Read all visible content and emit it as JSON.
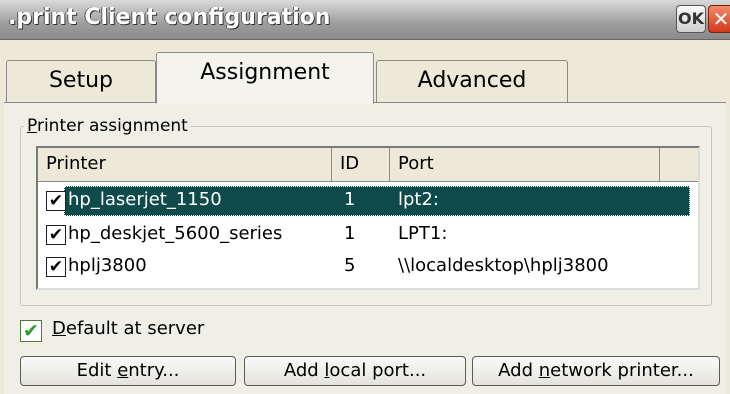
{
  "window": {
    "title": ".print Client configuration",
    "ok_label": "OK",
    "close_glyph": "✕"
  },
  "tabs": [
    {
      "label": "Setup"
    },
    {
      "label": "Assignment"
    },
    {
      "label": "Advanced"
    }
  ],
  "active_tab": "Assignment",
  "group": {
    "label_first": "P",
    "label_rest": "rinter assignment"
  },
  "table": {
    "columns": [
      "Printer",
      "ID",
      "Port"
    ],
    "rows": [
      {
        "checked": "✔",
        "printer": "hp_laserjet_1150",
        "id": "1",
        "port": "lpt2:",
        "selected": true
      },
      {
        "checked": "✔",
        "printer": "hp_deskjet_5600_series",
        "id": "1",
        "port": "LPT1:",
        "selected": false
      },
      {
        "checked": "✔",
        "printer": "hplj3800",
        "id": "5",
        "port": "\\\\localdesktop\\hplj3800",
        "selected": false
      }
    ]
  },
  "default_server": {
    "checked": "✔",
    "label_first": "D",
    "label_rest": "efault at server"
  },
  "buttons": {
    "edit": {
      "before": "Edit ",
      "underlined": "e",
      "after": "ntry..."
    },
    "add_local": {
      "before": "Add ",
      "underlined": "l",
      "after": "ocal port..."
    },
    "add_network": {
      "before": "Add ",
      "underlined": "n",
      "after": "etwork printer..."
    }
  },
  "colors": {
    "selection": "#0f4b4b",
    "title_bar": "#9e9e9e",
    "close": "#d5361a"
  }
}
